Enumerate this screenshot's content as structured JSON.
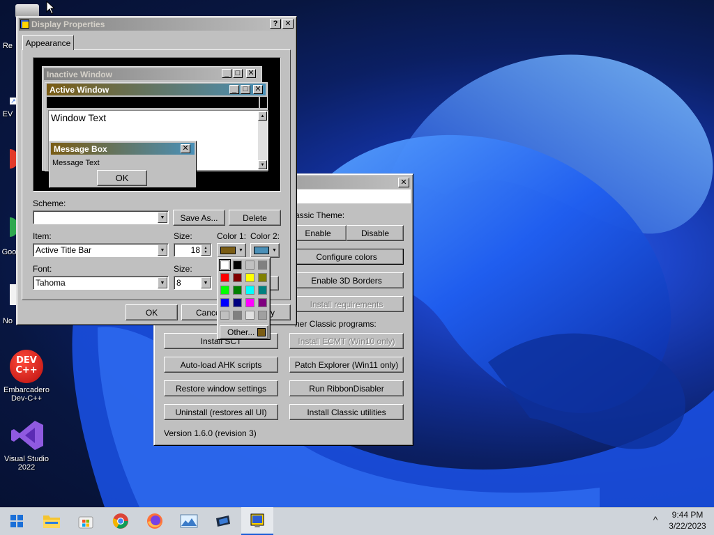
{
  "desktop": {
    "icons": [
      {
        "label": "Embarcadero Dev-C++",
        "line1": "Embarcadero",
        "line2": "Dev-C++",
        "badge": "DEV C++"
      },
      {
        "label": "Visual Studio 2022",
        "line1": "Visual Studio",
        "line2": "2022"
      }
    ],
    "partial_labels": {
      "recycle": "Re",
      "ev": "EV",
      "goog": "Goo",
      "no": "No"
    },
    "wallpaper_colors": {
      "deep": "#061031",
      "mid": "#12309b",
      "bright": "#2f64e8"
    }
  },
  "back_window": {
    "classic_theme_label": "assic Theme:",
    "enable_label": "Enable",
    "disable_label": "Disable",
    "configure_colors_label": "Configure colors",
    "enable_3d_label": "Enable 3D Borders",
    "install_requirements_label": "Install requirements",
    "other_programs_label": "her Classic programs:",
    "install_sct_label": "Install SCT",
    "install_ecmt_label": "Install ECMT (Win10 only)",
    "autoload_ahk_label": "Auto-load AHK scripts",
    "patch_explorer_label": "Patch Explorer (Win11 only)",
    "restore_window_label": "Restore window settings",
    "run_ribbon_label": "Run RibbonDisabler",
    "uninstall_label": "Uninstall (restores all UI)",
    "install_utilities_label": "Install Classic utilities",
    "version_text": "Version 1.6.0 (revision 3)"
  },
  "display_properties": {
    "title": "Display Properties",
    "help_btn": "?",
    "close_btn": "✕",
    "tab_appearance": "Appearance",
    "preview": {
      "inactive_title": "Inactive Window",
      "active_title": "Active Window",
      "window_text": "Window Text",
      "message_box_title": "Message Box",
      "message_text": "Message Text",
      "ok_label": "OK"
    },
    "scheme_label": "Scheme:",
    "scheme_value": "",
    "save_as_label": "Save As...",
    "delete_label": "Delete",
    "item_label": "Item:",
    "item_value": "Active Title Bar",
    "size_label": "Size:",
    "item_size_value": "18",
    "color1_label": "Color 1:",
    "color2_label": "Color 2:",
    "color1_value": "#7a5c14",
    "color2_value": "#4a90b8",
    "font_label": "Font:",
    "font_value": "Tahoma",
    "font_size_label": "Size:",
    "font_size_value": "8",
    "ok_label": "OK",
    "cancel_label": "Cance",
    "apply_label": "y"
  },
  "color_picker": {
    "colors": [
      "#ffffff",
      "#000000",
      "#c0c0c0",
      "#808080",
      "#ff0000",
      "#800000",
      "#ffff00",
      "#808000",
      "#00ff00",
      "#008000",
      "#00ffff",
      "#008080",
      "#0000ff",
      "#000080",
      "#ff00ff",
      "#800080",
      "#c0c0c0",
      "#808080",
      "#e0e0e0",
      "#a0a0a0"
    ],
    "other_label": "Other...",
    "other_swatch": "#7a5c14"
  },
  "taskbar": {
    "time": "9:44 PM",
    "date": "3/22/2023",
    "chevron": "^",
    "apps": [
      "start",
      "file-explorer",
      "microsoft-store",
      "chrome",
      "firefox",
      "photos",
      "winaero",
      "display-properties"
    ]
  }
}
